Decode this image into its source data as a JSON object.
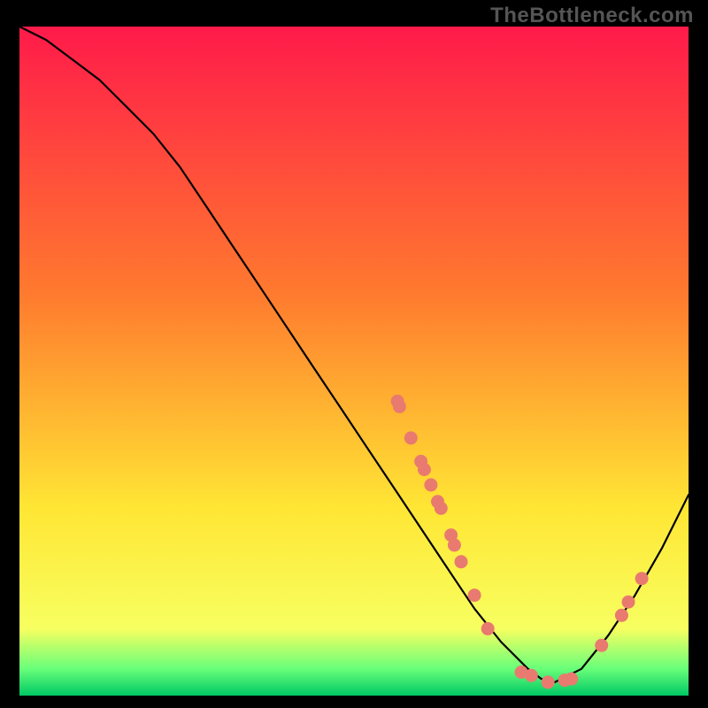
{
  "watermark": "TheBottleneck.com",
  "colors": {
    "gradient_top": "#ff1a4a",
    "gradient_mid1": "#ff7a2e",
    "gradient_mid2": "#ffe634",
    "gradient_bottom1": "#f7ff60",
    "gradient_bottom2": "#68ff7a",
    "gradient_bottom3": "#00c864",
    "curve": "#000000",
    "dot": "#e97a6f",
    "background": "#000000"
  },
  "chart_data": {
    "type": "line",
    "title": "",
    "xlabel": "",
    "ylabel": "",
    "xlim": [
      0,
      100
    ],
    "ylim": [
      0,
      100
    ],
    "curve": {
      "x": [
        0,
        4,
        8,
        12,
        16,
        20,
        24,
        28,
        32,
        36,
        40,
        44,
        48,
        52,
        56,
        60,
        64,
        68,
        72,
        76,
        78,
        80,
        84,
        88,
        92,
        96,
        100
      ],
      "y": [
        100,
        98,
        95,
        92,
        88,
        84,
        79,
        73,
        67,
        61,
        55,
        49,
        43,
        37,
        31,
        25,
        19,
        13,
        8,
        4,
        2.5,
        2,
        4,
        9,
        15,
        22,
        30
      ]
    },
    "dots": [
      {
        "x": 56.5,
        "y": 44.0
      },
      {
        "x": 56.8,
        "y": 43.2
      },
      {
        "x": 58.5,
        "y": 38.5
      },
      {
        "x": 60.0,
        "y": 35.0
      },
      {
        "x": 60.5,
        "y": 33.8
      },
      {
        "x": 61.5,
        "y": 31.5
      },
      {
        "x": 62.5,
        "y": 29.0
      },
      {
        "x": 63.0,
        "y": 28.0
      },
      {
        "x": 64.5,
        "y": 24.0
      },
      {
        "x": 65.0,
        "y": 22.5
      },
      {
        "x": 66.0,
        "y": 20.0
      },
      {
        "x": 68.0,
        "y": 15.0
      },
      {
        "x": 70.0,
        "y": 10.0
      },
      {
        "x": 75.0,
        "y": 3.5
      },
      {
        "x": 76.5,
        "y": 3.0
      },
      {
        "x": 79.0,
        "y": 2.0
      },
      {
        "x": 81.5,
        "y": 2.3
      },
      {
        "x": 82.5,
        "y": 2.5
      },
      {
        "x": 87.0,
        "y": 7.5
      },
      {
        "x": 90.0,
        "y": 12.0
      },
      {
        "x": 91.0,
        "y": 14.0
      },
      {
        "x": 93.0,
        "y": 17.5
      }
    ]
  }
}
